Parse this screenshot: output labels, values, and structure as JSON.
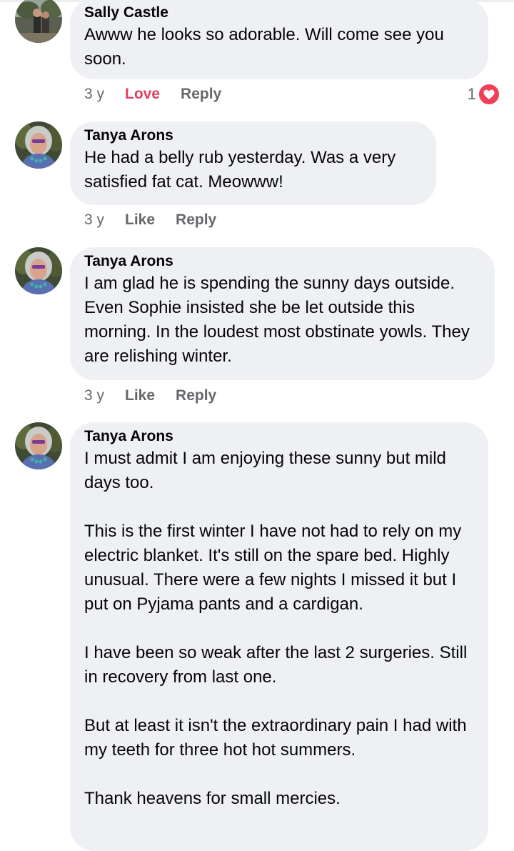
{
  "comments": [
    {
      "author": "Sally Castle",
      "paragraphs": [
        "Awww he looks so adorable.  Will come see you soon."
      ],
      "time": "3 y",
      "react_label": "Love",
      "reply_label": "Reply",
      "reaction_count": "1",
      "reaction_type": "love-heart",
      "reacted": true
    },
    {
      "author": "Tanya Arons",
      "paragraphs": [
        "He had a belly rub yesterday.  Was a very satisfied fat cat.  Meowww!"
      ],
      "time": "3 y",
      "react_label": "Like",
      "reply_label": "Reply"
    },
    {
      "author": "Tanya Arons",
      "paragraphs": [
        "I  am glad he is spending the sunny days outside.  Even Sophie insisted she be let outside this morning.  In the loudest most obstinate yowls.  They are relishing winter."
      ],
      "time": "3 y",
      "react_label": "Like",
      "reply_label": "Reply"
    },
    {
      "author": "Tanya Arons",
      "paragraphs": [
        "I must admit I am enjoying these sunny but mild days too.",
        "This is the first winter I have not had to rely on my electric blanket.  It's still on the spare bed.  Highly unusual.  There were a few nights I missed it but I put on Pyjama pants and a cardigan.",
        "I have been so weak after the last 2 surgeries.  Still in recovery from last one.",
        "But at least it isn't the extraordinary pain I had with my teeth for three hot hot summers.",
        "Thank heavens for small mercies."
      ]
    }
  ],
  "colors": {
    "bubble": "#eff0f4",
    "meta_text": "#65676b",
    "love": "#e0405d",
    "heart_badge": "#f33e58"
  }
}
